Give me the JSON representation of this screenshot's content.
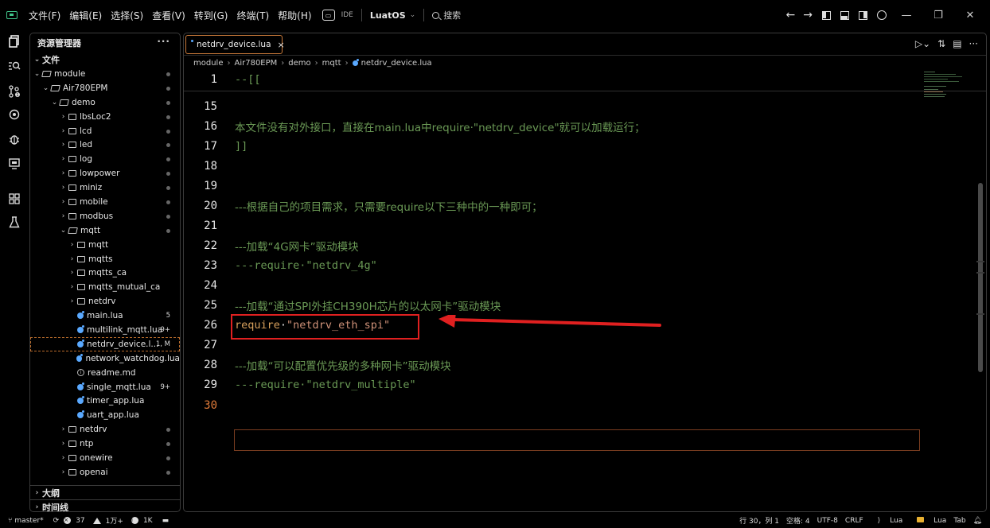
{
  "menu": [
    "文件(F)",
    "编辑(E)",
    "选择(S)",
    "查看(V)",
    "转到(G)",
    "终端(T)",
    "帮助(H)"
  ],
  "ide_label": "IDE",
  "workspace": "LuatOS",
  "search_label": "搜索",
  "sidebar": {
    "title": "资源管理器",
    "more": "···",
    "section_files": "文件",
    "tree": [
      {
        "label": "module",
        "indent": 0,
        "kind": "folder-open",
        "marker": "dot"
      },
      {
        "label": "Air780EPM",
        "indent": 1,
        "kind": "folder-open",
        "marker": "dot"
      },
      {
        "label": "demo",
        "indent": 2,
        "kind": "folder-open",
        "marker": "dot"
      },
      {
        "label": "lbsLoc2",
        "indent": 3,
        "kind": "folder",
        "marker": "dot"
      },
      {
        "label": "lcd",
        "indent": 3,
        "kind": "folder",
        "marker": "dot"
      },
      {
        "label": "led",
        "indent": 3,
        "kind": "folder",
        "marker": "dot"
      },
      {
        "label": "log",
        "indent": 3,
        "kind": "folder",
        "marker": "dot"
      },
      {
        "label": "lowpower",
        "indent": 3,
        "kind": "folder",
        "marker": "dot"
      },
      {
        "label": "miniz",
        "indent": 3,
        "kind": "folder",
        "marker": "dot"
      },
      {
        "label": "mobile",
        "indent": 3,
        "kind": "folder",
        "marker": "dot"
      },
      {
        "label": "modbus",
        "indent": 3,
        "kind": "folder",
        "marker": "dot"
      },
      {
        "label": "mqtt",
        "indent": 3,
        "kind": "folder-open",
        "marker": "dot"
      },
      {
        "label": "mqtt",
        "indent": 4,
        "kind": "folder",
        "marker": ""
      },
      {
        "label": "mqtts",
        "indent": 4,
        "kind": "folder",
        "marker": ""
      },
      {
        "label": "mqtts_ca",
        "indent": 4,
        "kind": "folder",
        "marker": ""
      },
      {
        "label": "mqtts_mutual_ca",
        "indent": 4,
        "kind": "folder",
        "marker": ""
      },
      {
        "label": "netdrv",
        "indent": 4,
        "kind": "folder",
        "marker": ""
      },
      {
        "label": "main.lua",
        "indent": 4,
        "kind": "lua",
        "marker": "5"
      },
      {
        "label": "multilink_mqtt.lua",
        "indent": 4,
        "kind": "lua",
        "marker": "9+"
      },
      {
        "label": "netdrv_device.l...",
        "indent": 4,
        "kind": "lua",
        "marker": "1, M",
        "selected": true
      },
      {
        "label": "network_watchdog.lua",
        "indent": 4,
        "kind": "lua",
        "marker": ""
      },
      {
        "label": "readme.md",
        "indent": 4,
        "kind": "info",
        "marker": ""
      },
      {
        "label": "single_mqtt.lua",
        "indent": 4,
        "kind": "lua",
        "marker": "9+"
      },
      {
        "label": "timer_app.lua",
        "indent": 4,
        "kind": "lua",
        "marker": ""
      },
      {
        "label": "uart_app.lua",
        "indent": 4,
        "kind": "lua",
        "marker": ""
      },
      {
        "label": "netdrv",
        "indent": 3,
        "kind": "folder",
        "marker": "dot"
      },
      {
        "label": "ntp",
        "indent": 3,
        "kind": "folder",
        "marker": "dot"
      },
      {
        "label": "onewire",
        "indent": 3,
        "kind": "folder",
        "marker": "dot"
      },
      {
        "label": "openai",
        "indent": 3,
        "kind": "folder",
        "marker": "dot"
      }
    ],
    "section_outline": "大纲",
    "section_timeline": "时间线"
  },
  "editor": {
    "tab_label": "netdrv_device.lua",
    "tab_close": "×",
    "breadcrumb": [
      "module",
      "Air780EPM",
      "demo",
      "mqtt",
      "netdrv_device.lua"
    ],
    "lines": [
      {
        "n": "1",
        "parts": [
          {
            "t": "--[[",
            "c": "c-comment"
          }
        ]
      },
      {
        "n": "15",
        "parts": []
      },
      {
        "n": "16",
        "parts": [
          {
            "t": "本文件没有对外接口，直接在main.lua中require·\"netdrv_device\"就可以加载运行；",
            "c": "c-text"
          }
        ]
      },
      {
        "n": "17",
        "parts": [
          {
            "t": "]]",
            "c": "c-comment"
          }
        ]
      },
      {
        "n": "18",
        "parts": []
      },
      {
        "n": "19",
        "parts": []
      },
      {
        "n": "20",
        "parts": [
          {
            "t": "---根据自己的项目需求，只需要require以下三种中的一种即可；",
            "c": "c-text"
          }
        ]
      },
      {
        "n": "21",
        "parts": []
      },
      {
        "n": "22",
        "parts": [
          {
            "t": "---加载“4G网卡”驱动模块",
            "c": "c-text"
          }
        ]
      },
      {
        "n": "23",
        "parts": [
          {
            "t": "---require·\"netdrv_4g\"",
            "c": "c-comment"
          }
        ]
      },
      {
        "n": "24",
        "parts": []
      },
      {
        "n": "25",
        "parts": [
          {
            "t": "---加载“通过SPI外挂CH390H芯片的以太网卡”驱动模块",
            "c": "c-text"
          }
        ]
      },
      {
        "n": "26",
        "parts": [
          {
            "t": "require",
            "c": "c-kw"
          },
          {
            "t": "·",
            "c": "c-plain"
          },
          {
            "t": "\"netdrv_eth_spi\"",
            "c": "c-str"
          }
        ]
      },
      {
        "n": "27",
        "parts": []
      },
      {
        "n": "28",
        "parts": [
          {
            "t": "---加载“可以配置优先级的多种网卡”驱动模块",
            "c": "c-text"
          }
        ]
      },
      {
        "n": "29",
        "parts": [
          {
            "t": "---require·\"netdrv_multiple\"",
            "c": "c-comment"
          }
        ]
      },
      {
        "n": "30",
        "parts": [],
        "active": true
      }
    ]
  },
  "statusbar": {
    "branch": "master*",
    "errors": "37",
    "warnings": "1万+",
    "infos": "1K",
    "position": "行 30，列 1",
    "spaces": "空格: 4",
    "encoding": "UTF-8",
    "eol": "CRLF",
    "language": "Lua",
    "lua_ext": "Lua",
    "tab": "Tab"
  },
  "colors": {
    "accent_orange": "#c97a3a",
    "annotation_red": "#e02020",
    "comment_green": "#6a9955",
    "string": "#ce9178",
    "keyword": "#d7a05c"
  }
}
